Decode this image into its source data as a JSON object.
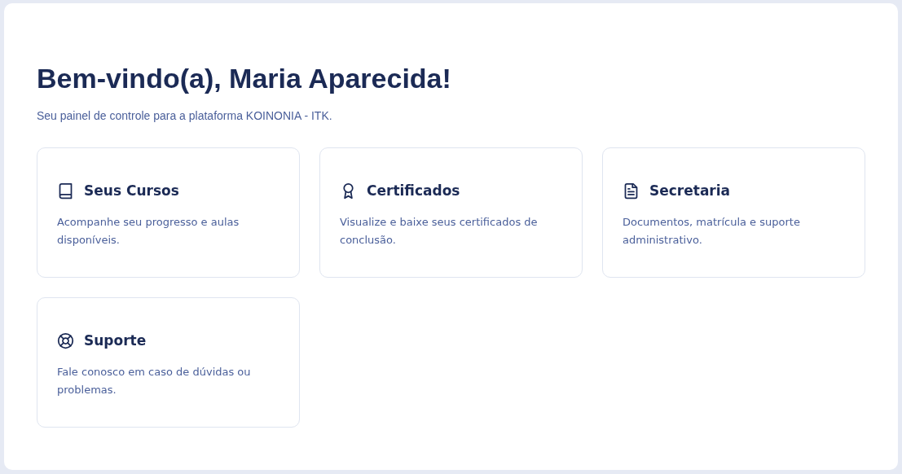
{
  "header": {
    "title": "Bem-vindo(a), Maria Aparecida!",
    "subtitle": "Seu painel de controle para a plataforma KOINONIA - ITK."
  },
  "cards": [
    {
      "kind": "book",
      "title": "Seus Cursos",
      "description": "Acompanhe seu progresso e aulas disponíveis."
    },
    {
      "kind": "award",
      "title": "Certificados",
      "description": "Visualize e baixe seus certificados de conclusão."
    },
    {
      "kind": "document",
      "title": "Secretaria",
      "description": "Documentos, matrícula e suporte administrativo."
    },
    {
      "kind": "lifebuoy",
      "title": "Suporte",
      "description": "Fale conosco em caso de dúvidas ou problemas."
    }
  ]
}
